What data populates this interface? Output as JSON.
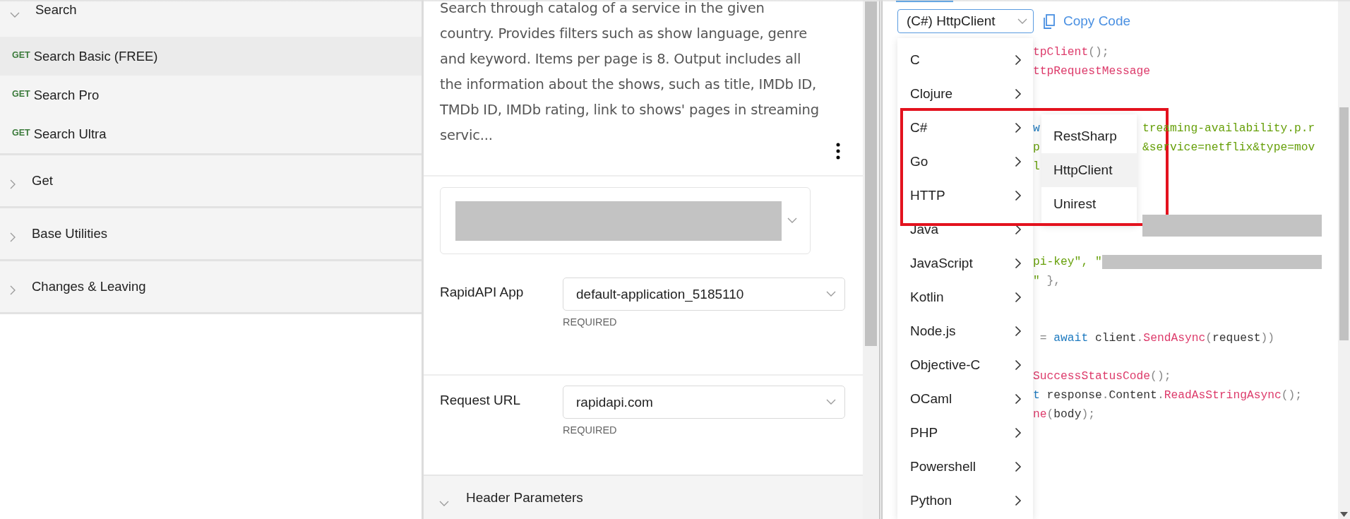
{
  "sidebar": {
    "groups": [
      {
        "label": "Search",
        "expanded": true,
        "items": [
          {
            "method": "GET",
            "label": "Search Basic (FREE)",
            "selected": true
          },
          {
            "method": "GET",
            "label": "Search Pro",
            "selected": false
          },
          {
            "method": "GET",
            "label": "Search Ultra",
            "selected": false
          }
        ]
      },
      {
        "label": "Get",
        "expanded": false
      },
      {
        "label": "Base Utilities",
        "expanded": false
      },
      {
        "label": "Changes & Leaving",
        "expanded": false
      }
    ]
  },
  "endpoint": {
    "description": "Search through catalog of a service in the given country. Provides filters such as show language, genre and keyword. Items per page is 8. Output includes all the information about the shows, such as title, IMDb ID, TMDb ID, IMDb rating, link to shows' pages in streaming servic...",
    "fields": [
      {
        "label": "RapidAPI App",
        "value": "default-application_5185110",
        "note": "REQUIRED"
      },
      {
        "label": "Request URL",
        "value": "rapidapi.com",
        "note": "REQUIRED"
      }
    ],
    "sections": [
      {
        "label": "Header Parameters",
        "expanded": true
      }
    ]
  },
  "code": {
    "snippet_select": "(C#) HttpClient",
    "copy_button": "Copy Code",
    "lines": [
      {
        "kind": "code",
        "left": [
          {
            "t": "tpClient",
            "kind": "method"
          },
          {
            "t": "();",
            "kind": "punct"
          }
        ]
      },
      {
        "kind": "code",
        "left": [
          {
            "t": "ttpRequestMessage",
            "kind": "method"
          }
        ]
      },
      {
        "kind": "blank"
      },
      {
        "kind": "blank"
      },
      {
        "kind": "code",
        "left": [
          {
            "t": "w",
            "kind": "keyword"
          }
        ],
        "right": [
          {
            "t": "treaming-availability.p.r",
            "kind": "string"
          }
        ]
      },
      {
        "kind": "code",
        "left": [
          {
            "t": "p",
            "kind": "string"
          }
        ],
        "right": [
          {
            "t": "&service=netflix&type=mov",
            "kind": "string"
          }
        ]
      },
      {
        "kind": "code",
        "left": [
          {
            "t": "l",
            "kind": "string"
          }
        ]
      },
      {
        "kind": "blank"
      },
      {
        "kind": "blank"
      },
      {
        "kind": "code",
        "right": [
          {
            "kind": "redacted"
          }
        ]
      },
      {
        "kind": "blank"
      },
      {
        "kind": "code",
        "left": [
          {
            "t": "pi-key\", \"",
            "kind": "string"
          },
          {
            "kind": "redacted"
          }
        ]
      },
      {
        "kind": "code",
        "left": [
          {
            "t": "\"",
            "kind": "string"
          },
          {
            "t": " },",
            "kind": "punct"
          }
        ]
      },
      {
        "kind": "blank"
      },
      {
        "kind": "blank"
      },
      {
        "kind": "code",
        "left": [
          {
            "t": " = ",
            "kind": "punct"
          },
          {
            "t": "await",
            "kind": "keyword"
          },
          {
            "t": " client",
            "kind": "plain"
          },
          {
            "t": ".",
            "kind": "punct"
          },
          {
            "t": "SendAsync",
            "kind": "method"
          },
          {
            "t": "(",
            "kind": "punct"
          },
          {
            "t": "request",
            "kind": "plain"
          },
          {
            "t": "))",
            "kind": "punct"
          }
        ]
      },
      {
        "kind": "blank"
      },
      {
        "kind": "code",
        "left": [
          {
            "t": "SuccessStatusCode",
            "kind": "method"
          },
          {
            "t": "();",
            "kind": "punct"
          }
        ]
      },
      {
        "kind": "code",
        "left": [
          {
            "t": "t",
            "kind": "keyword"
          },
          {
            "t": " response",
            "kind": "plain"
          },
          {
            "t": ".",
            "kind": "punct"
          },
          {
            "t": "Content",
            "kind": "plain"
          },
          {
            "t": ".",
            "kind": "punct"
          },
          {
            "t": "ReadAsStringAsync",
            "kind": "method"
          },
          {
            "t": "();",
            "kind": "punct"
          }
        ]
      },
      {
        "kind": "code",
        "left": [
          {
            "t": "ne",
            "kind": "method"
          },
          {
            "t": "(",
            "kind": "punct"
          },
          {
            "t": "body",
            "kind": "plain"
          },
          {
            "t": ");",
            "kind": "punct"
          }
        ]
      }
    ],
    "language_menu": [
      {
        "label": "C"
      },
      {
        "label": "Clojure"
      },
      {
        "label": "C#",
        "children": [
          {
            "label": "RestSharp",
            "selected": false
          },
          {
            "label": "HttpClient",
            "selected": true
          },
          {
            "label": "Unirest",
            "selected": false
          }
        ]
      },
      {
        "label": "Go"
      },
      {
        "label": "HTTP"
      },
      {
        "label": "Java"
      },
      {
        "label": "JavaScript"
      },
      {
        "label": "Kotlin"
      },
      {
        "label": "Node.js"
      },
      {
        "label": "Objective-C"
      },
      {
        "label": "OCaml"
      },
      {
        "label": "PHP"
      },
      {
        "label": "Powershell"
      },
      {
        "label": "Python"
      }
    ]
  }
}
